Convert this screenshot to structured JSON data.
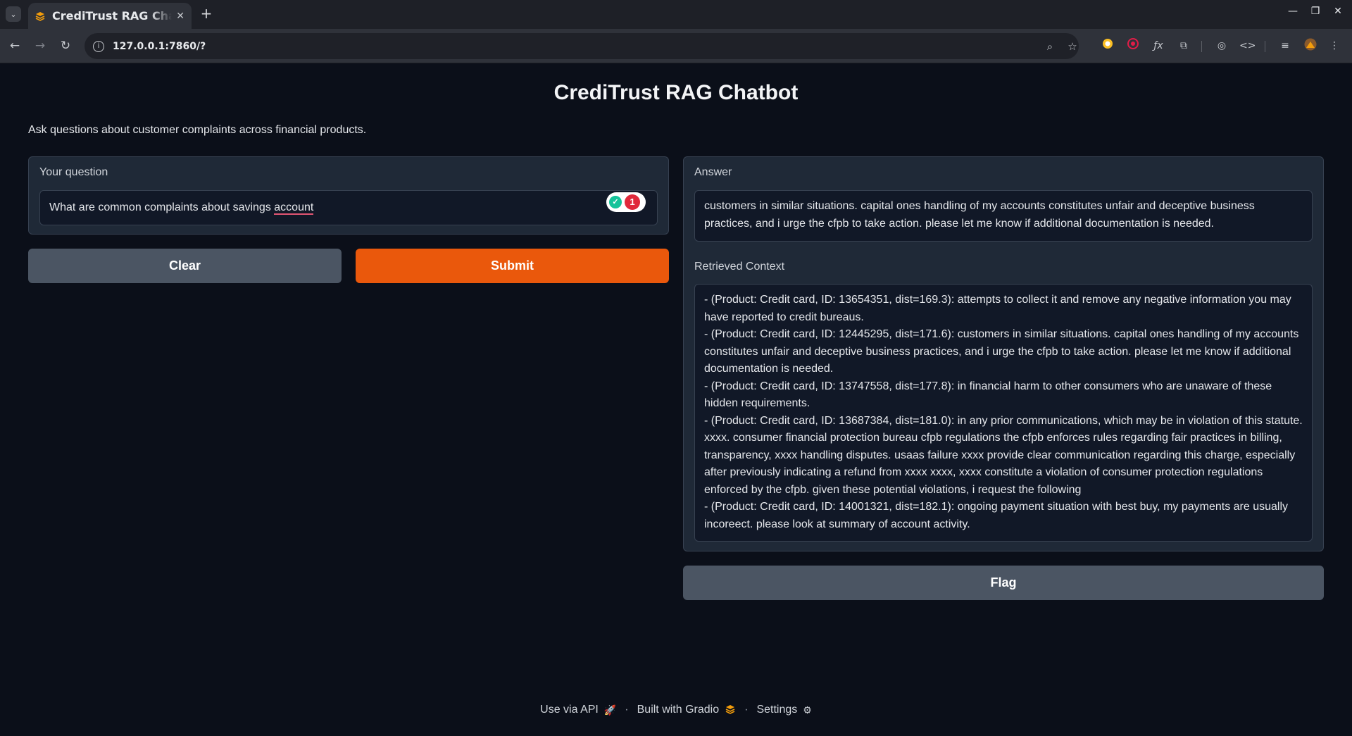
{
  "browser": {
    "tab_title": "CrediTrust RAG Chatbot",
    "url": "127.0.0.1:7860/?"
  },
  "app": {
    "title": "CrediTrust RAG Chatbot",
    "description": "Ask questions about customer complaints across financial products."
  },
  "question": {
    "label": "Your question",
    "value_prefix": "What are common complaints about savings ",
    "value_underlined": "account",
    "grammarly_count": "1"
  },
  "buttons": {
    "clear": "Clear",
    "submit": "Submit",
    "flag": "Flag"
  },
  "answer": {
    "label": "Answer",
    "value": "customers in similar situations. capital ones handling of my accounts constitutes unfair and deceptive business practices, and i urge the cfpb to take action. please let me know if additional documentation is needed."
  },
  "context": {
    "label": "Retrieved Context",
    "value": "- (Product: Credit card, ID: 13654351, dist=169.3): attempts to collect it and remove any negative information you may have reported to credit bureaus.\n- (Product: Credit card, ID: 12445295, dist=171.6): customers in similar situations. capital ones handling of my accounts constitutes unfair and deceptive business practices, and i urge the cfpb to take action. please let me know if additional documentation is needed.\n- (Product: Credit card, ID: 13747558, dist=177.8): in financial harm to other consumers who are unaware of these hidden requirements.\n- (Product: Credit card, ID: 13687384, dist=181.0): in any prior communications, which may be in violation of this statute. xxxx. consumer financial protection bureau cfpb regulations the cfpb enforces rules regarding fair practices in billing, transparency, xxxx handling disputes. usaas failure xxxx provide clear communication regarding this charge, especially after previously indicating a refund from xxxx xxxx, xxxx constitute a violation of consumer protection regulations enforced by the cfpb. given these potential violations, i request the following\n- (Product: Credit card, ID: 14001321, dist=182.1): ongoing payment situation with best buy, my payments are usually incoreect. please look at summary of account activity."
  },
  "footer": {
    "api": "Use via API",
    "built": "Built with Gradio",
    "settings": "Settings"
  },
  "colors": {
    "primary": "#ea580c",
    "secondary": "#4b5563",
    "background": "#0b0f19",
    "panel": "#1f2937"
  }
}
